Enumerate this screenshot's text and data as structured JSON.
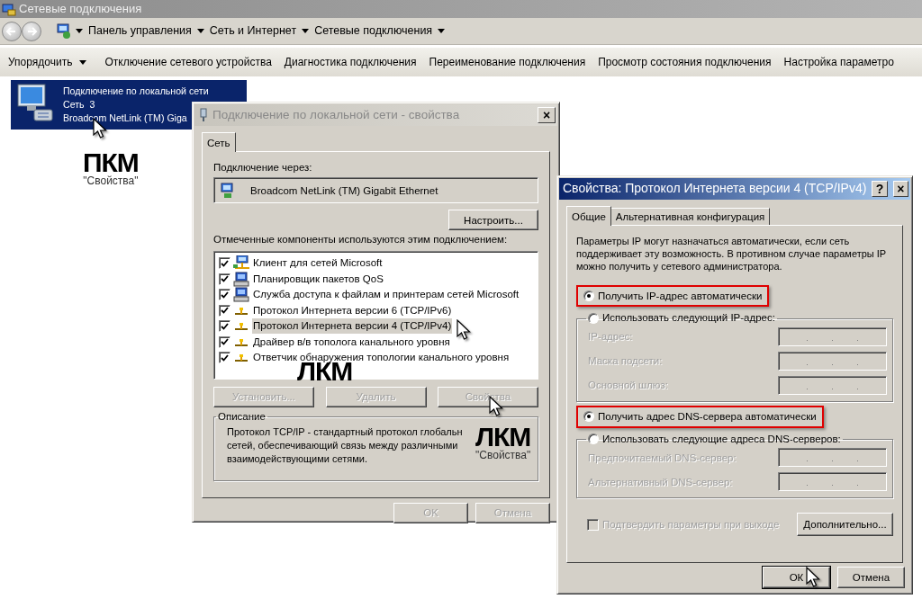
{
  "explorer": {
    "title": "Сетевые подключения",
    "breadcrumb": [
      {
        "label": "Панель управления"
      },
      {
        "label": "Сеть и Интернет"
      },
      {
        "label": "Сетевые подключения"
      }
    ],
    "toolbar": [
      {
        "label": "Упорядочить",
        "dropdown": true
      },
      {
        "label": "Отключение сетевого устройства",
        "dropdown": false
      },
      {
        "label": "Диагностика подключения",
        "dropdown": false
      },
      {
        "label": "Переименование подключения",
        "dropdown": false
      },
      {
        "label": "Просмотр состояния подключения",
        "dropdown": false
      },
      {
        "label": "Настройка параметро",
        "dropdown": false
      }
    ],
    "connection": {
      "name": "Подключение по локальной сети",
      "network": "Сеть  3",
      "adapter": "Broadcom NetLink (TM) Giga",
      "selected": true
    }
  },
  "annotations": [
    {
      "title": "ПКМ",
      "caption": "\"Свойства\""
    },
    {
      "title": "ЛКМ"
    },
    {
      "title": "ЛКМ",
      "caption": "\"Свойства\""
    }
  ],
  "properties_dialog": {
    "title": "Подключение по локальной сети - свойства",
    "active": false,
    "close": "×",
    "tabs": [
      {
        "label": "Сеть",
        "selected": true
      }
    ],
    "connect_label": "Подключение через:",
    "adapter": "Broadcom NetLink (TM) Gigabit Ethernet",
    "configure_button": "Настроить...",
    "components_label": "Отмеченные компоненты используются этим подключением:",
    "components": [
      {
        "kind": "client",
        "label": "Клиент для сетей Microsoft",
        "checked": true,
        "selected": false
      },
      {
        "kind": "service",
        "label": "Планировщик пакетов QoS",
        "checked": true,
        "selected": false
      },
      {
        "kind": "service",
        "label": "Служба доступа к файлам и принтерам сетей Microsoft",
        "checked": true,
        "selected": false
      },
      {
        "kind": "protocol",
        "label": "Протокол Интернета версии 6 (TCP/IPv6)",
        "checked": true,
        "selected": false
      },
      {
        "kind": "protocol",
        "label": "Протокол Интернета версии 4 (TCP/IPv4)",
        "checked": true,
        "selected": true
      },
      {
        "kind": "protocol",
        "label": "Драйвер в/в тополога канального уровня",
        "checked": true,
        "selected": false
      },
      {
        "kind": "protocol",
        "label": "Ответчик обнаружения топологии канального уровня",
        "checked": true,
        "selected": false
      }
    ],
    "buttons": [
      {
        "label": "Установить...",
        "disabled": true
      },
      {
        "label": "Удалить",
        "disabled": true
      },
      {
        "label": "Свойства",
        "disabled": true
      }
    ],
    "description_title": "Описание",
    "description_lines": [
      "Протокол TCP/IP - стандартный протокол глобальн",
      "сетей, обеспечивающий связь между различными",
      "взаимодействующими сетями."
    ],
    "footer_buttons": [
      {
        "label": "OK",
        "disabled": true
      },
      {
        "label": "Отмена",
        "disabled": true
      }
    ]
  },
  "ipv4_dialog": {
    "title": "Свойства: Протокол Интернета версии 4 (TCP/IPv4)",
    "active": true,
    "title_buttons": [
      "?",
      "×"
    ],
    "tabs": [
      {
        "label": "Общие",
        "selected": true
      },
      {
        "label": "Альтернативная конфигурация",
        "selected": false
      }
    ],
    "intro_lines": [
      "Параметры IP могут назначаться автоматически, если сеть",
      "поддерживает эту возможность. В противном случае параметры IP",
      "можно получить у сетевого администратора."
    ],
    "ip_options": [
      {
        "label": "Получить IP-адрес автоматически",
        "selected": true,
        "highlighted": true
      },
      {
        "label": "Использовать следующий IP-адрес:",
        "selected": false,
        "highlighted": false
      }
    ],
    "ip_fields": [
      {
        "label": "IP-адрес:",
        "disabled": true
      },
      {
        "label": "Маска подсети:",
        "disabled": true
      },
      {
        "label": "Основной шлюз:",
        "disabled": true
      }
    ],
    "dns_options": [
      {
        "label": "Получить адрес DNS-сервера автоматически",
        "selected": true,
        "highlighted": true
      },
      {
        "label": "Использовать следующие адреса DNS-серверов:",
        "selected": false,
        "highlighted": false
      }
    ],
    "dns_fields": [
      {
        "label": "Предпочитаемый DNS-сервер:",
        "disabled": true
      },
      {
        "label": "Альтернативный DNS-сервер:",
        "disabled": true
      }
    ],
    "confirm": {
      "label": "Подтвердить параметры при выходе",
      "checked": false,
      "disabled": true
    },
    "advanced_button": "Дополнительно...",
    "footer_buttons": [
      {
        "label": "ОК",
        "disabled": false
      },
      {
        "label": "Отмена",
        "disabled": false
      }
    ]
  }
}
